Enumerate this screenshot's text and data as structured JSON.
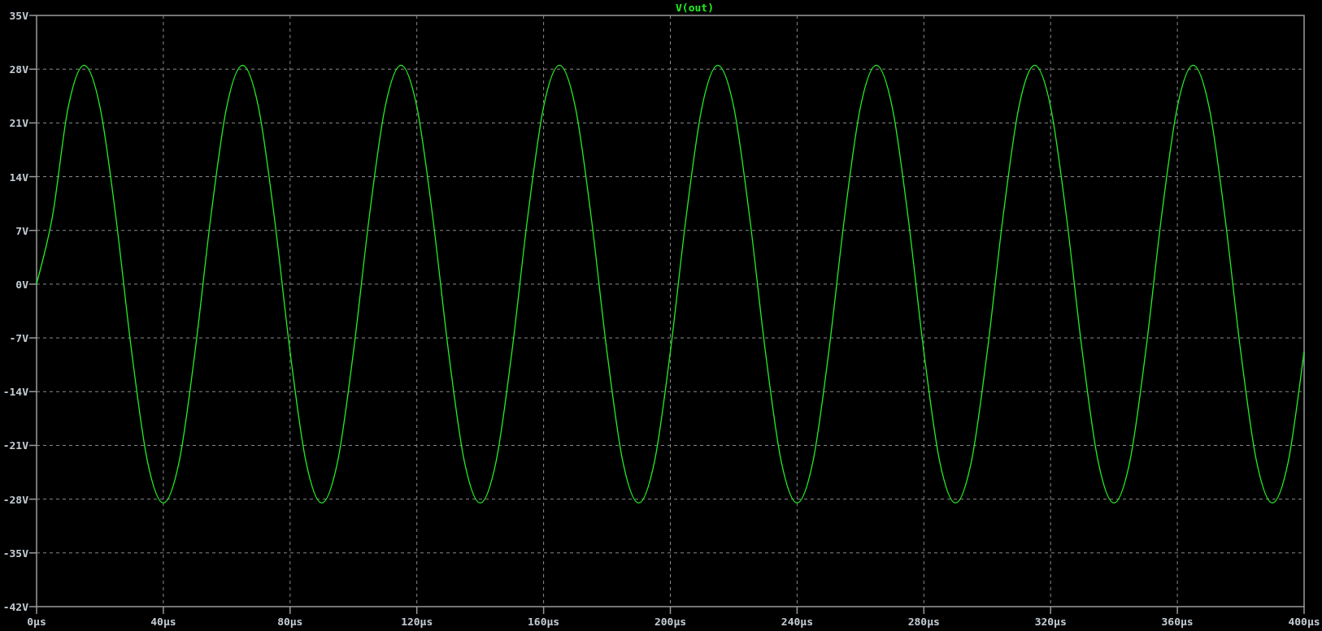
{
  "plot": {
    "chart_data": {
      "type": "line",
      "grid": true,
      "x": [
        0,
        5,
        10,
        15,
        20,
        25,
        30,
        35,
        40,
        45,
        50,
        55,
        60,
        65,
        70,
        75,
        80,
        85,
        90,
        95,
        100,
        105,
        110,
        115,
        120,
        125,
        130,
        135,
        140,
        145,
        150,
        155,
        160,
        165,
        170,
        175,
        180,
        185,
        190,
        195,
        200,
        205,
        210,
        215,
        220,
        225,
        230,
        235,
        240,
        245,
        250,
        255,
        260,
        265,
        270,
        275,
        280,
        285,
        290,
        295,
        300,
        305,
        310,
        315,
        320,
        325,
        330,
        335,
        340,
        345,
        350,
        355,
        360,
        365,
        370,
        375,
        380,
        385,
        390,
        395,
        400
      ],
      "series": [
        {
          "name": "V(out)",
          "color": "#22ee22",
          "values": [
            0,
            8.8,
            23.1,
            28.5,
            23.1,
            8.8,
            -8.8,
            -23.1,
            -28.5,
            -23.1,
            -8.8,
            8.8,
            23.1,
            28.5,
            23.1,
            8.8,
            -8.8,
            -23.1,
            -28.5,
            -23.1,
            -8.8,
            8.8,
            23.1,
            28.5,
            23.1,
            8.8,
            -8.8,
            -23.1,
            -28.5,
            -23.1,
            -8.8,
            8.8,
            23.1,
            28.5,
            23.1,
            8.8,
            -8.8,
            -23.1,
            -28.5,
            -23.1,
            -8.8,
            8.8,
            23.1,
            28.5,
            23.1,
            8.8,
            -8.8,
            -23.1,
            -28.5,
            -23.1,
            -8.8,
            8.8,
            23.1,
            28.5,
            23.1,
            8.8,
            -8.8,
            -23.1,
            -28.5,
            -23.1,
            -8.8,
            8.8,
            23.1,
            28.5,
            23.1,
            8.8,
            -8.8,
            -23.1,
            -28.5,
            -23.1,
            -8.8,
            8.8,
            23.1,
            28.5,
            23.1,
            8.8,
            -8.8,
            -23.1,
            -28.5,
            -23.1,
            -8.8
          ]
        }
      ],
      "xlim": [
        0,
        400
      ],
      "ylim": [
        -42,
        35
      ],
      "xticks": [
        {
          "value": 0,
          "label": "0µs"
        },
        {
          "value": 40,
          "label": "40µs"
        },
        {
          "value": 80,
          "label": "80µs"
        },
        {
          "value": 120,
          "label": "120µs"
        },
        {
          "value": 160,
          "label": "160µs"
        },
        {
          "value": 200,
          "label": "200µs"
        },
        {
          "value": 240,
          "label": "240µs"
        },
        {
          "value": 280,
          "label": "280µs"
        },
        {
          "value": 320,
          "label": "320µs"
        },
        {
          "value": 360,
          "label": "360µs"
        },
        {
          "value": 400,
          "label": "400µs"
        }
      ],
      "yticks": [
        {
          "value": 35,
          "label": "35V"
        },
        {
          "value": 28,
          "label": "28V"
        },
        {
          "value": 21,
          "label": "21V"
        },
        {
          "value": 14,
          "label": "14V"
        },
        {
          "value": 7,
          "label": "7V"
        },
        {
          "value": 0,
          "label": "0V"
        },
        {
          "value": -7,
          "label": "-7V"
        },
        {
          "value": -14,
          "label": "-14V"
        },
        {
          "value": -21,
          "label": "-21V"
        },
        {
          "value": -28,
          "label": "-28V"
        },
        {
          "value": -35,
          "label": "-35V"
        },
        {
          "value": -42,
          "label": "-42V"
        }
      ]
    }
  }
}
